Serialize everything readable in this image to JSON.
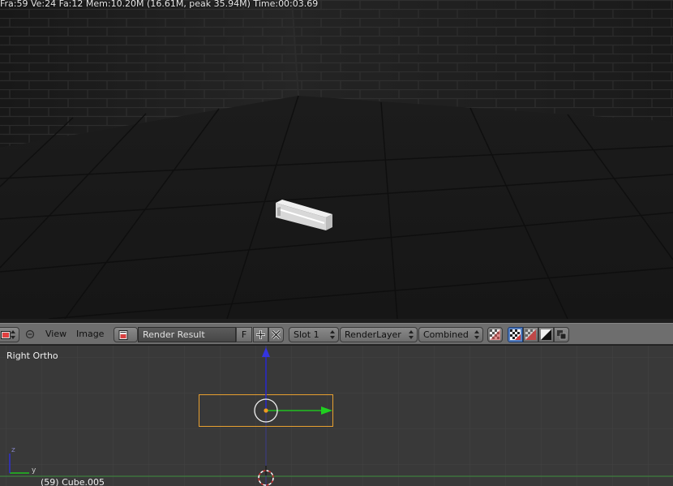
{
  "render": {
    "stats_text": "Fra:59  Ve:24 Fa:12 Mem:10.20M (16.61M, peak 35.94M) Time:00:03.69"
  },
  "header": {
    "editor_type_icon": "image-editor-icon",
    "collapse_icon": "minus-circle-icon",
    "menus": [
      "View",
      "Image"
    ],
    "image_browse_icon": "image-browse-icon",
    "image_name": "Render Result",
    "fake_user_label": "F",
    "new_icon": "plus-icon",
    "unlink_icon": "close-icon",
    "slot": "Slot 1",
    "render_layer": "RenderLayer",
    "pass": "Combined",
    "draw_mode_icons": [
      "checker-alpha-icon",
      "color-alpha-icon",
      "color-icon",
      "alpha-icon",
      "z-buffer-icon"
    ]
  },
  "viewport": {
    "view_name": "Right Ortho",
    "object_info": "(59) Cube.005",
    "axis_labels": {
      "y": "y",
      "z": "z"
    }
  },
  "colors": {
    "header_bg": "#6e6e6e",
    "viewport_bg": "#393939",
    "selection_outline": "#e8a030",
    "axis_y": "#28c828",
    "axis_z": "#3030d0"
  }
}
